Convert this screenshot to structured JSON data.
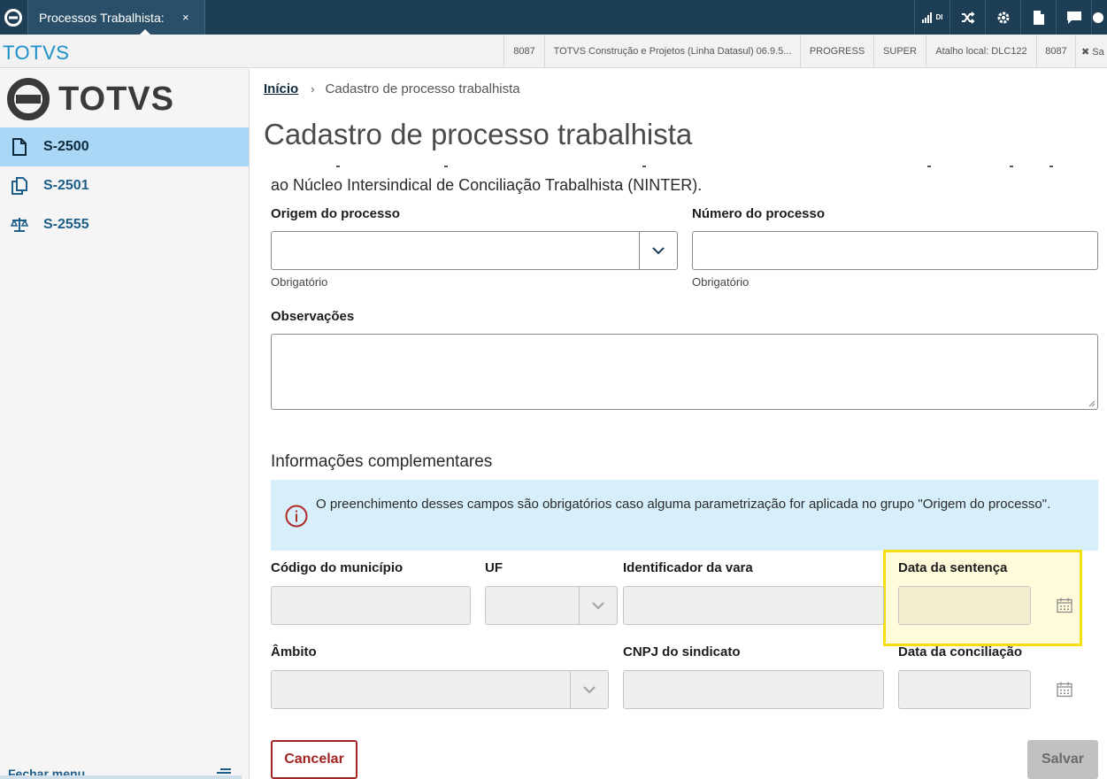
{
  "topbar": {
    "tab_label": "Processos Trabalhista:",
    "tab_close": "×",
    "signal_label": "DI",
    "icons": [
      "signal-icon",
      "shuffle-icon",
      "gear-icon",
      "document-icon",
      "chat-icon",
      "power-icon"
    ]
  },
  "infobar": {
    "brand": "TOTVS",
    "cells": [
      "8087",
      "TOTVS Construção e Projetos (Linha Datasul) 06.9.5...",
      "PROGRESS",
      "SUPER",
      "Atalho local: DLC122",
      "8087",
      "✖ Sa"
    ]
  },
  "sidebar": {
    "logo_text": "TOTVS",
    "items": [
      {
        "label": "S-2500",
        "icon": "document-icon",
        "active": true
      },
      {
        "label": "S-2501",
        "icon": "copy-icon",
        "active": false
      },
      {
        "label": "S-2555",
        "icon": "scale-icon",
        "active": false
      }
    ],
    "footer_label": "Fechar menu"
  },
  "breadcrumb": {
    "home": "Início",
    "separator": "›",
    "current": "Cadastro de processo trabalhista"
  },
  "page": {
    "title": "Cadastro de processo trabalhista",
    "cut_text": "ao Núcleo Intersindical de Conciliação Trabalhista (NINTER)."
  },
  "form": {
    "origem_label": "Origem do processo",
    "origem_helper": "Obrigatório",
    "numero_label": "Número do processo",
    "numero_helper": "Obrigatório",
    "observacoes_label": "Observações",
    "section_title": "Informações complementares",
    "alert_text": "O preenchimento desses campos são obrigatórios caso alguma parametrização for aplicada no grupo \"Origem do processo\".",
    "codigo_municipio_label": "Código do município",
    "uf_label": "UF",
    "identificador_vara_label": "Identificador da vara",
    "data_sentenca_label": "Data da sentença",
    "ambito_label": "Âmbito",
    "cnpj_sindicato_label": "CNPJ do sindicato",
    "data_conciliacao_label": "Data da conciliação"
  },
  "actions": {
    "cancel_label": "Cancelar",
    "save_label": "Salvar"
  },
  "colors": {
    "topbar": "#1d3e54",
    "accent": "#1a8fc9",
    "sidebar_active": "#a9d7f5",
    "alert_bg": "#d7effa",
    "danger": "#a32424",
    "highlight_border": "#f5df12"
  }
}
